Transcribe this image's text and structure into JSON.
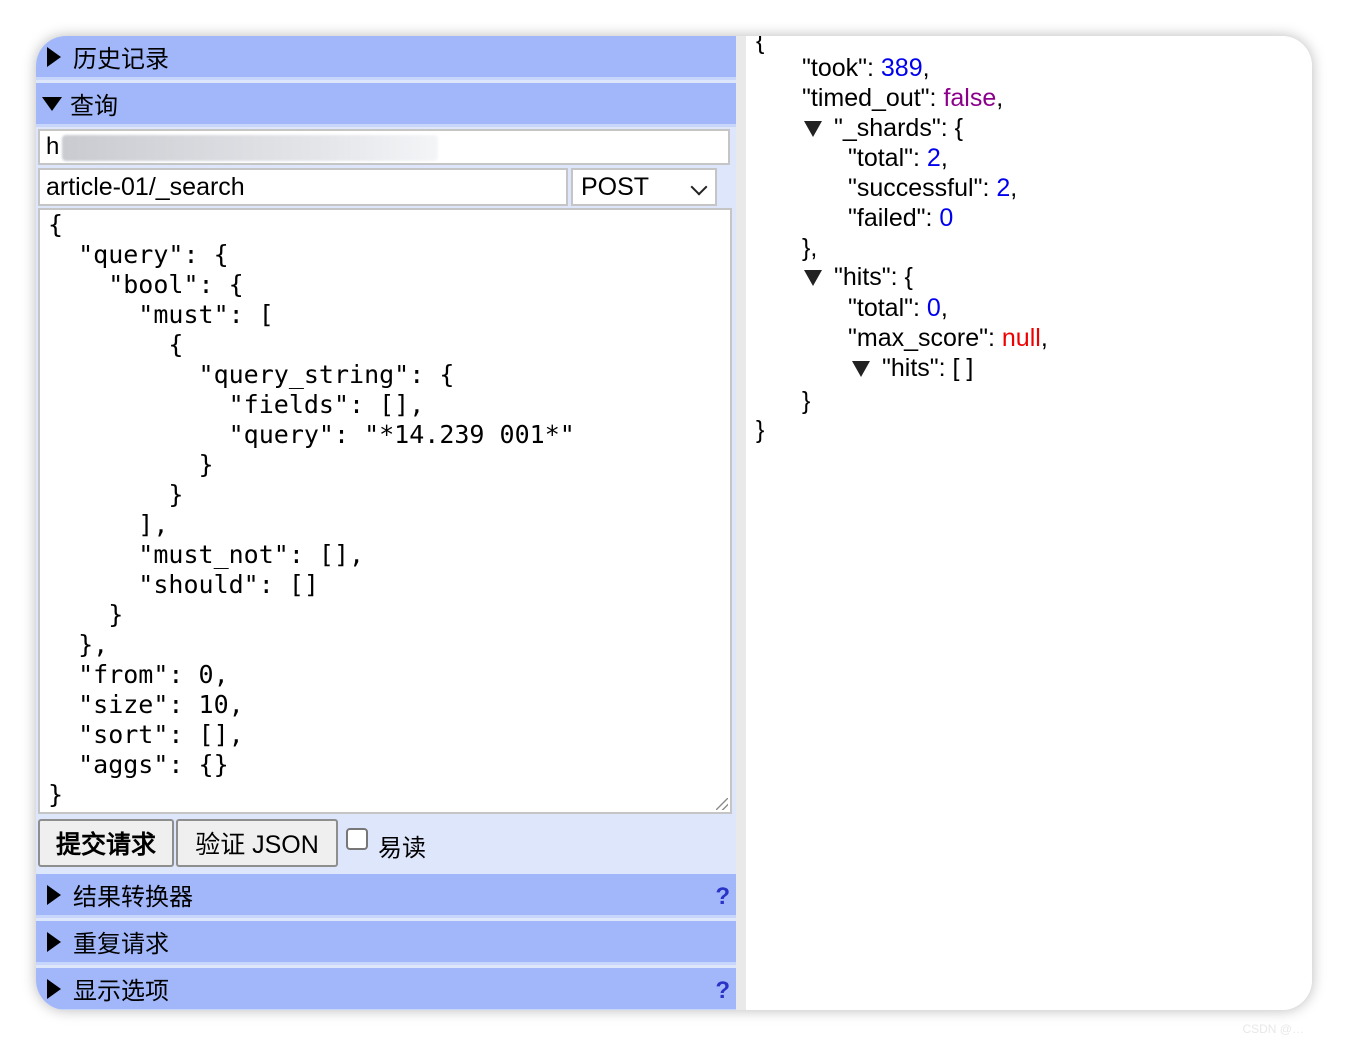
{
  "sections": {
    "history": "历史记录",
    "query": "查询",
    "transformer": "结果转换器",
    "repeat": "重复请求",
    "display": "显示选项"
  },
  "request": {
    "url_value": "h",
    "path_value": "article-01/_search",
    "method": "POST",
    "body_lines": [
      "{",
      "  \"query\": {",
      "    \"bool\": {",
      "      \"must\": [",
      "        {",
      "          \"query_string\": {",
      "            \"fields\": [],",
      "            \"query\": \"*14.239 001*\"",
      "          }",
      "        }",
      "      ],",
      "      \"must_not\": [],",
      "      \"should\": []",
      "    }",
      "  },",
      "  \"from\": 0,",
      "  \"size\": 10,",
      "  \"sort\": [],",
      "  \"aggs\": {}",
      "}"
    ]
  },
  "buttons": {
    "submit": "提交请求",
    "validate": "验证 JSON",
    "pretty_label": "易读",
    "help": "?"
  },
  "response": {
    "open_brace": "{",
    "took_key": "\"took\": ",
    "took_val": "389",
    "timed_out_key": "\"timed_out\": ",
    "timed_out_val": "false",
    "shards_key": "\"_shards\": {",
    "shards_total_key": "\"total\": ",
    "shards_total_val": "2",
    "shards_successful_key": "\"successful\": ",
    "shards_successful_val": "2",
    "shards_failed_key": "\"failed\": ",
    "shards_failed_val": "0",
    "shards_close": "},",
    "hits_key": "\"hits\": {",
    "hits_total_key": "\"total\": ",
    "hits_total_val": "0",
    "max_score_key": "\"max_score\": ",
    "max_score_val": "null",
    "inner_hits": "\"hits\": [ ]",
    "hits_close": "}",
    "close_brace": "}"
  },
  "colors": {
    "section_header": "#a1b7fa",
    "panel_bg": "#dee6fb",
    "number": "#0000ee",
    "boolean": "#8b008b",
    "null": "#ee0000",
    "help": "#2a33c7"
  },
  "watermark": "CSDN @…"
}
